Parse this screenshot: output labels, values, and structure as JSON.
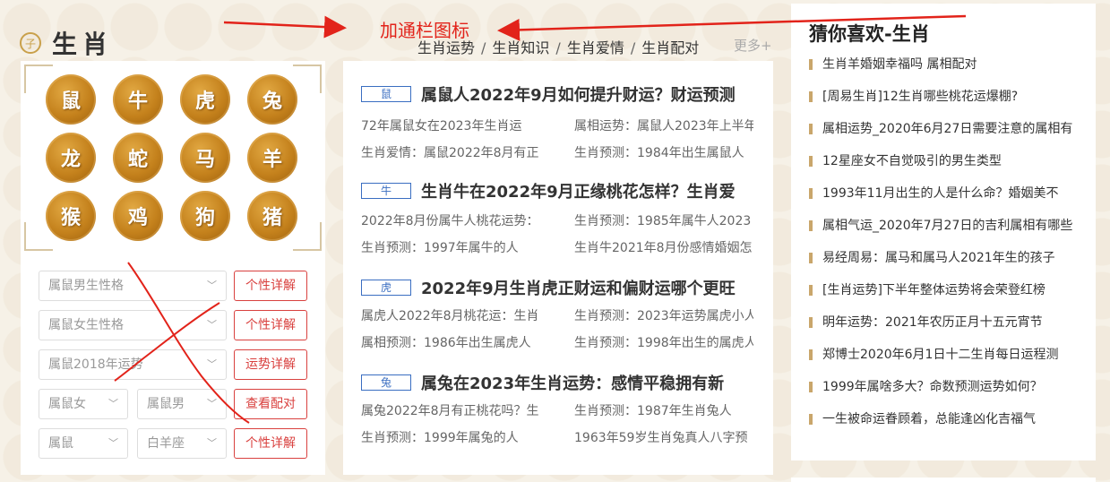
{
  "header": {
    "logo_char": "子",
    "title": "生肖"
  },
  "zodiac_grid": [
    "鼠",
    "牛",
    "虎",
    "兔",
    "龙",
    "蛇",
    "马",
    "羊",
    "猴",
    "鸡",
    "狗",
    "猪"
  ],
  "controls": {
    "rows": [
      {
        "selects": [
          "属鼠男生性格"
        ],
        "button": "个性详解"
      },
      {
        "selects": [
          "属鼠女生性格"
        ],
        "button": "个性详解"
      },
      {
        "selects": [
          "属鼠2018年运势"
        ],
        "button": "运势详解"
      },
      {
        "selects": [
          "属鼠女",
          "属鼠男"
        ],
        "button": "查看配对"
      },
      {
        "selects": [
          "属鼠",
          "白羊座"
        ],
        "button": "个性详解"
      }
    ]
  },
  "tabs": {
    "items": [
      "生肖运势",
      "生肖知识",
      "生肖爱情",
      "生肖配对"
    ],
    "separator": "/",
    "more": "更多+"
  },
  "articles": [
    {
      "tag": "鼠",
      "title": "属鼠人2022年9月如何提升财运？财运预测",
      "lines": [
        "72年属鼠女在2023年生肖运",
        "属相运势：属鼠人2023年上半年",
        "生肖爱情：属鼠2022年8月有正",
        "生肖预测：1984年出生属鼠人"
      ]
    },
    {
      "tag": "牛",
      "title": "生肖牛在2022年9月正缘桃花怎样？生肖爱",
      "lines": [
        "2022年8月份属牛人桃花运势：",
        "生肖预测：1985年属牛人2023",
        "生肖预测：1997年属牛的人",
        "生肖牛2021年8月份感情婚姻怎"
      ]
    },
    {
      "tag": "虎",
      "title": "2022年9月生肖虎正财运和偏财运哪个更旺",
      "lines": [
        "属虎人2022年8月桃花运：生肖",
        "生肖预测：2023年运势属虎小人",
        "属相预测：1986年出生属虎人",
        "生肖预测：1998年出生的属虎人"
      ]
    },
    {
      "tag": "兔",
      "title": "属兔在2023年生肖运势：感情平稳拥有新",
      "lines": [
        "属兔2022年8月有正桃花吗？生",
        "生肖预测：1987年生肖兔人",
        "生肖预测：1999年属兔的人",
        "1963年59岁生肖兔真人八字预"
      ]
    }
  ],
  "recommend": {
    "title": "猜你喜欢-生肖",
    "items": [
      "生肖羊婚姻幸福吗 属相配对",
      "[周易生肖]12生肖哪些桃花运爆棚?",
      "属相运势_2020年6月27日需要注意的属相有",
      "12星座女不自觉吸引的男生类型",
      "1993年11月出生的人是什么命？婚姻美不",
      "属相气运_2020年7月27日的吉利属相有哪些",
      "易经周易：属马和属马人2021年生的孩子",
      "[生肖运势]下半年整体运势将会荣登红榜",
      "明年运势：2021年农历正月十五元宵节",
      "郑博士2020年6月1日十二生肖每日运程测",
      "1999年属啥多大？命数预测运势如何？",
      "一生被命运眷顾着，总能逢凶化吉福气"
    ]
  },
  "annotation": {
    "text": "加通栏图标",
    "color": "#e2231a"
  },
  "colors": {
    "accent_red": "#d9413f",
    "tag_blue": "#3a6ec1",
    "gold": "#c4811c",
    "background": "#f6f1e7"
  }
}
